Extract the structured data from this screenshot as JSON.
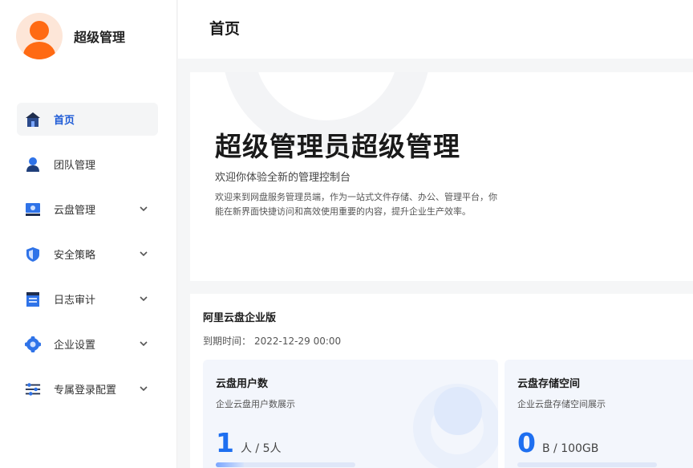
{
  "brand": {
    "name": "超级管理"
  },
  "header": {
    "title": "首页"
  },
  "sidebar": {
    "items": [
      {
        "label": "首页",
        "icon": "home-icon",
        "active": true,
        "expandable": false
      },
      {
        "label": "团队管理",
        "icon": "team-icon",
        "active": false,
        "expandable": false
      },
      {
        "label": "云盘管理",
        "icon": "cloud-disk-icon",
        "active": false,
        "expandable": true
      },
      {
        "label": "安全策略",
        "icon": "shield-icon",
        "active": false,
        "expandable": true
      },
      {
        "label": "日志审计",
        "icon": "log-icon",
        "active": false,
        "expandable": true
      },
      {
        "label": "企业设置",
        "icon": "gear-icon",
        "active": false,
        "expandable": true
      },
      {
        "label": "专属登录配置",
        "icon": "sliders-icon",
        "active": false,
        "expandable": true
      }
    ]
  },
  "hero": {
    "title": "超级管理员超级管理",
    "subtitle": "欢迎你体验全新的管理控制台",
    "description": "欢迎来到网盘服务管理员端，作为一站式文件存储、办公、管理平台，你能在新界面快捷访问和高效使用重要的内容，提升企业生产效率。"
  },
  "enterprise": {
    "title": "阿里云盘企业版",
    "expiry_label": "到期时间：",
    "expiry_value": "2022-12-29 00:00",
    "cards": [
      {
        "title": "云盘用户数",
        "desc": "企业云盘用户数展示",
        "value": "1",
        "unit": "人 / 5人",
        "progress": 0.2
      },
      {
        "title": "云盘存储空间",
        "desc": "企业云盘存储空间展示",
        "value": "0",
        "unit": "B / 100GB",
        "progress": 0.0
      }
    ]
  },
  "colors": {
    "accent": "#1e6ff0",
    "brand_orange": "#ff6a13",
    "active_nav": "#1e5bd6"
  }
}
